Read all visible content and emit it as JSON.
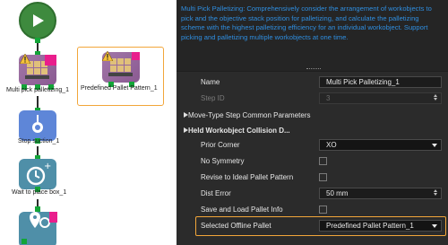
{
  "canvas": {
    "nodes": {
      "multi_pick": "Multi pick palletizing_1",
      "predefined": "Predefined Pallet Pattern_1",
      "stop_suction": "Stop suction_1",
      "wait_place": "Wait to place box_1"
    }
  },
  "description": "Multi Pick Palletizing: Comprehensively consider the arrangement of workobjects to pick and the objective stack position for palletizing, and calculate the palletizing scheme with the highest palletizing efficiency for an individual workobject. Support picking and palletizing multiple workobjects at one time.",
  "properties": {
    "name_label": "Name",
    "name_value": "Multi Pick Palletizing_1",
    "step_id_label": "Step ID",
    "step_id_value": "3",
    "move_type_section": "Move-Type Step Common Parameters",
    "held_section": "Held Workobject Collision D...",
    "prior_corner_label": "Prior Corner",
    "prior_corner_value": "XO",
    "no_symmetry_label": "No Symmetry",
    "revise_label": "Revise to Ideal Pallet Pattern",
    "dist_error_label": "Dist Error",
    "dist_error_value": "50 mm",
    "save_load_label": "Save and Load Pallet Info",
    "offline_pallet_label": "Selected Offline Pallet",
    "offline_pallet_value": "Predefined Pallet Pattern_1"
  },
  "colors": {
    "description_text": "#2f8ee0",
    "highlight_frame": "#f2a63a",
    "port_green": "#13a538"
  }
}
